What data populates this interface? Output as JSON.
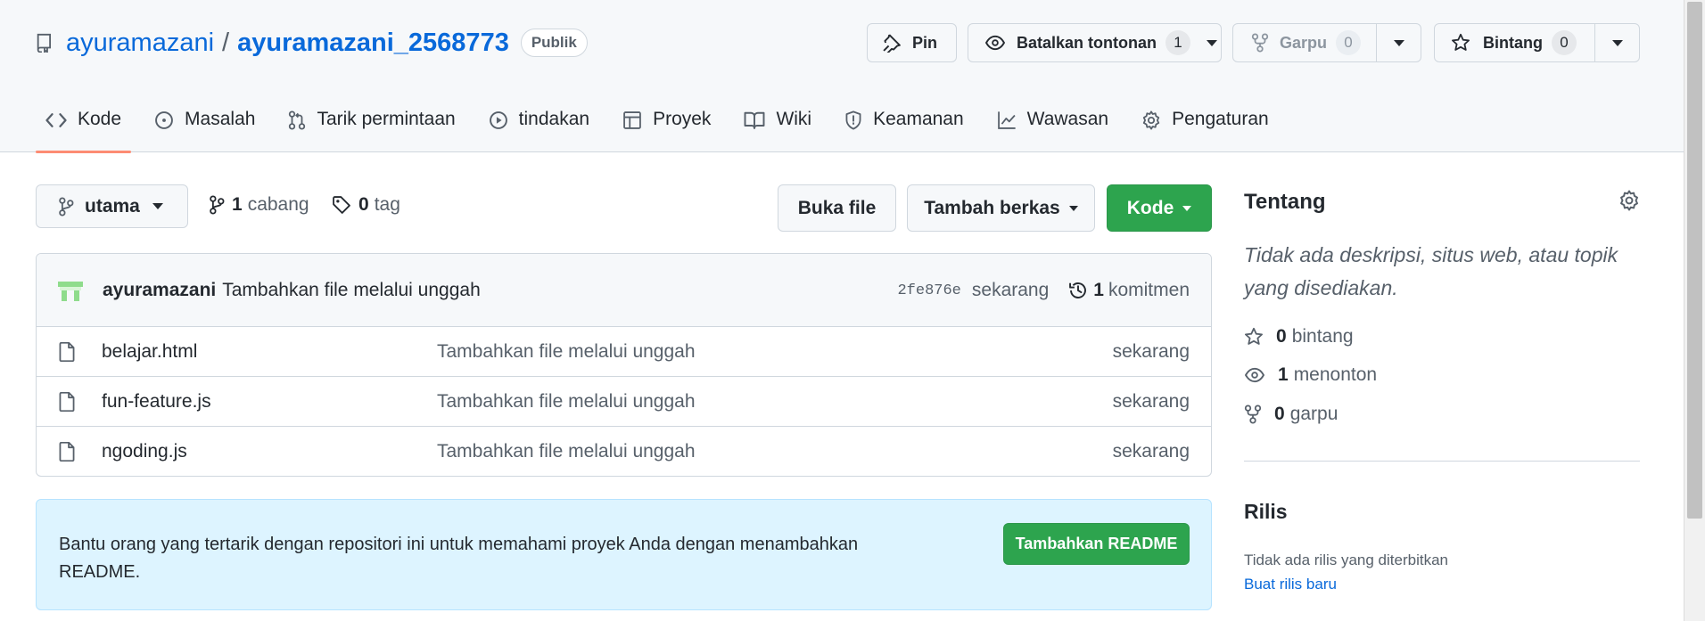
{
  "repo": {
    "owner": "ayuramazani",
    "separator": "/",
    "name": "ayuramazani_2568773",
    "visibility": "Publik"
  },
  "header_actions": {
    "pin_label": "Pin",
    "watch_label": "Batalkan tontonan",
    "watch_count": "1",
    "fork_label": "Garpu",
    "fork_count": "0",
    "star_label": "Bintang",
    "star_count": "0"
  },
  "nav": {
    "tabs": [
      {
        "label": "Kode",
        "icon": "code-icon",
        "active": true
      },
      {
        "label": "Masalah",
        "icon": "issue-icon"
      },
      {
        "label": "Tarik permintaan",
        "icon": "pull-request-icon"
      },
      {
        "label": "tindakan",
        "icon": "play-icon"
      },
      {
        "label": "Proyek",
        "icon": "table-icon"
      },
      {
        "label": "Wiki",
        "icon": "book-icon"
      },
      {
        "label": "Keamanan",
        "icon": "shield-icon"
      },
      {
        "label": "Wawasan",
        "icon": "graph-icon"
      },
      {
        "label": "Pengaturan",
        "icon": "gear-icon"
      }
    ]
  },
  "toolbar": {
    "branch": "utama",
    "branch_count": "1",
    "branch_label": "cabang",
    "tag_count": "0",
    "tag_label": "tag",
    "open_file_label": "Buka file",
    "add_file_label": "Tambah berkas",
    "code_label": "Kode"
  },
  "latest_commit": {
    "author": "ayuramazani",
    "message": "Tambahkan file melalui unggah",
    "sha": "2fe876e",
    "age": "sekarang",
    "commit_count": "1",
    "commit_label": "komitmen"
  },
  "files": [
    {
      "name": "belajar.html",
      "message": "Tambahkan file melalui unggah",
      "age": "sekarang"
    },
    {
      "name": "fun-feature.js",
      "message": "Tambahkan file melalui unggah",
      "age": "sekarang"
    },
    {
      "name": "ngoding.js",
      "message": "Tambahkan file melalui unggah",
      "age": "sekarang"
    }
  ],
  "readme_prompt": {
    "text": "Bantu orang yang tertarik dengan repositori ini untuk memahami proyek Anda dengan menambahkan README.",
    "button_label": "Tambahkan README"
  },
  "about": {
    "title": "Tentang",
    "description": "Tidak ada deskripsi, situs web, atau topik yang disediakan.",
    "stars_count": "0",
    "stars_label": "bintang",
    "watching_count": "1",
    "watching_label": "menonton",
    "forks_count": "0",
    "forks_label": "garpu"
  },
  "releases": {
    "title": "Rilis",
    "empty_text": "Tidak ada rilis yang diterbitkan",
    "create_link": "Buat rilis baru"
  },
  "colors": {
    "link": "#0969da",
    "primary_button": "#2da44e",
    "active_tab_underline": "#fd8c73",
    "readme_banner_bg": "#ddf4ff"
  }
}
